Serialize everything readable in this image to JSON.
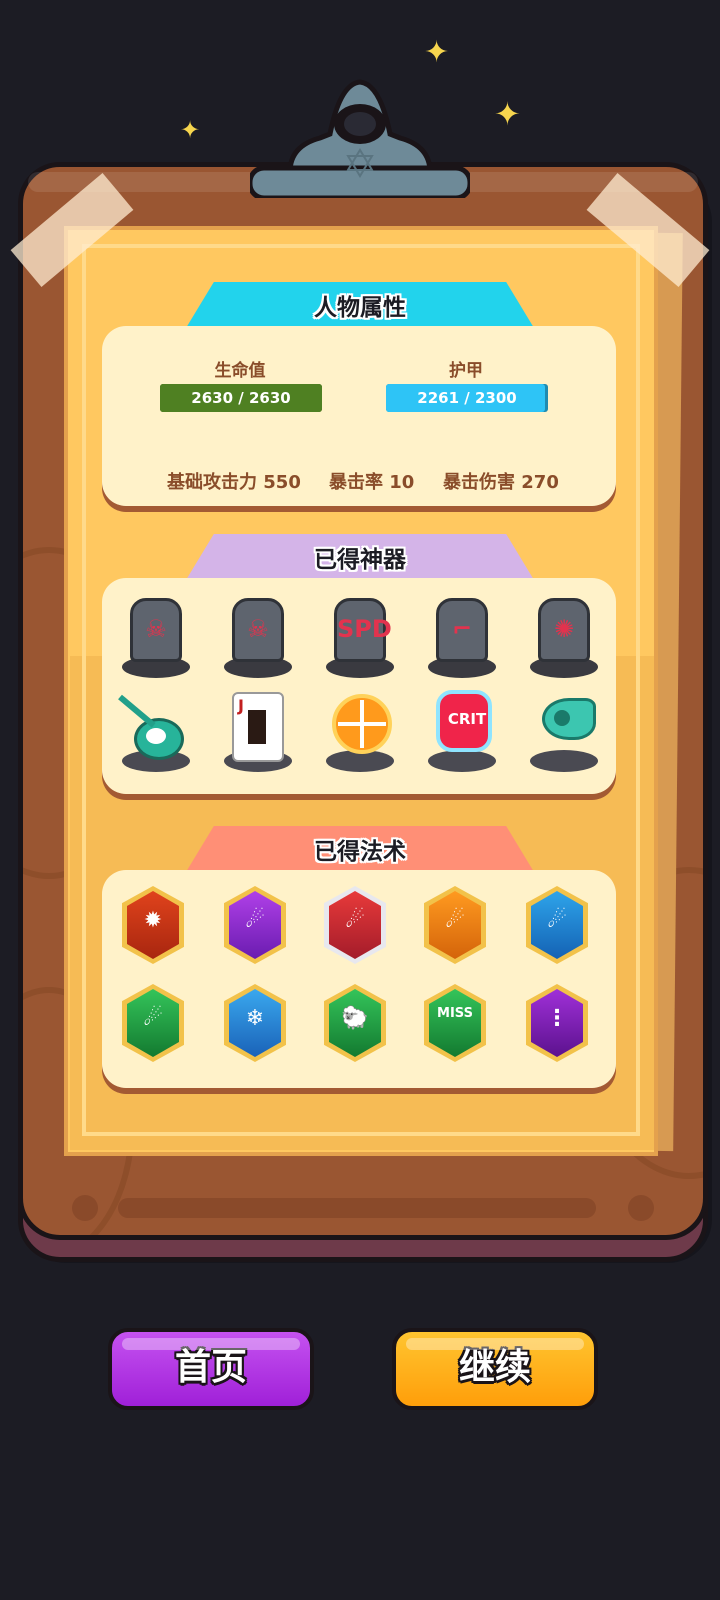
{
  "colors": {
    "background": "#1c1c24",
    "board": "#9a5632",
    "paper": "#ffc860",
    "card": "#fff2c9",
    "tab_attributes": "#22d3ec",
    "tab_artifacts": "#d4b4e8",
    "tab_spells": "#ff8f76",
    "hp_bar": "#4f8022",
    "armor_bar": "#2ec4f6",
    "home_button": "#b42fe6",
    "continue_button": "#ffac14"
  },
  "attributes": {
    "title": "人物属性",
    "hp": {
      "label": "生命值",
      "value": "2630 / 2630",
      "fill": 1.0
    },
    "armor": {
      "label": "护甲",
      "value": "2261 / 2300",
      "fill": 0.983
    },
    "base_attack": "基础攻击力 550",
    "crit_rate": "暴击率 10",
    "crit_damage": "暴击伤害 270"
  },
  "artifacts": {
    "title": "已得神器",
    "items": [
      {
        "icon": "tombstone-skull-fire-icon",
        "rune": "☠"
      },
      {
        "icon": "tombstone-skull-cross-icon",
        "rune": "☠"
      },
      {
        "icon": "tombstone-speed-icon",
        "rune": "SPD"
      },
      {
        "icon": "tombstone-boot-icon",
        "rune": "⌐"
      },
      {
        "icon": "tombstone-burst-icon",
        "rune": "✺"
      },
      {
        "icon": "dart-target-icon",
        "rune": ""
      },
      {
        "icon": "playing-card-icon",
        "rune": "J"
      },
      {
        "icon": "orange-slice-icon",
        "rune": ""
      },
      {
        "icon": "crit-potion-icon",
        "rune": "CRIT"
      },
      {
        "icon": "whistle-icon",
        "rune": ""
      }
    ]
  },
  "spells": {
    "title": "已得法术",
    "items": [
      {
        "icon": "fire-shield-spell-icon",
        "glyph": "✹"
      },
      {
        "icon": "purple-comet-spell-icon",
        "glyph": "☄"
      },
      {
        "icon": "red-comet-spell-icon",
        "glyph": "☄"
      },
      {
        "icon": "orange-comet-spell-icon",
        "glyph": "☄"
      },
      {
        "icon": "blue-comet-spell-icon",
        "glyph": "☄"
      },
      {
        "icon": "green-comet-spell-icon",
        "glyph": "☄"
      },
      {
        "icon": "frost-shield-spell-icon",
        "glyph": "❄"
      },
      {
        "icon": "sheep-spell-icon",
        "glyph": "🐑"
      },
      {
        "icon": "miss-spell-icon",
        "glyph": "MISS"
      },
      {
        "icon": "arcane-shield-spell-icon",
        "glyph": "⋮"
      }
    ]
  },
  "buttons": {
    "home": "首页",
    "continue": "继续"
  }
}
